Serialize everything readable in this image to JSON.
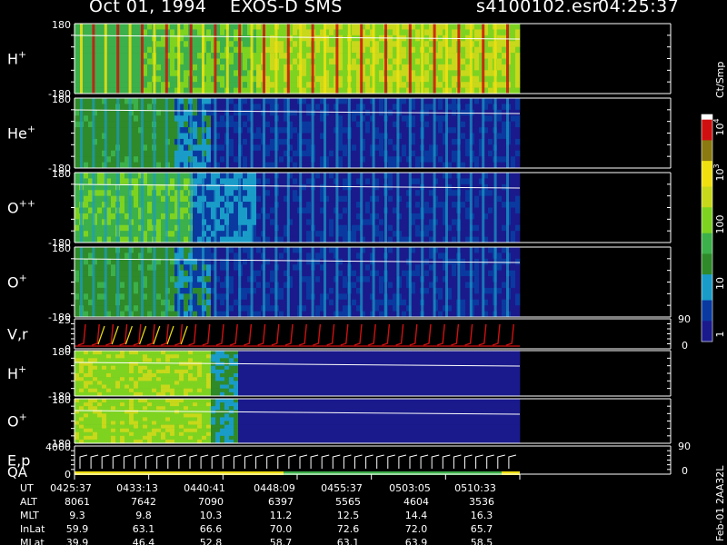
{
  "header": {
    "date": "Oct 01, 1994",
    "instrument": "EXOS-D SMS",
    "file": "s4100102.esr",
    "time": "04:25:37"
  },
  "colors": {
    "background": "#000000",
    "axes": "#ffffff",
    "scale": [
      "#1a1a8c",
      "#0a3aa0",
      "#1a9cc8",
      "#2f8a2a",
      "#3cb04a",
      "#7ed321",
      "#c8d81a",
      "#f0e010",
      "#8a7a10",
      "#d01010",
      "#ffffff"
    ]
  },
  "chart_data": {
    "type": "heatmap",
    "title": "Oct 01, 1994   EXOS-D SMS",
    "x_tick_labels": [
      "0425:37",
      "0433:13",
      "0440:41",
      "0448:09",
      "0455:37",
      "0503:05",
      "0510:33"
    ],
    "panels": [
      {
        "label": "H",
        "sup": "+",
        "ymax": "180",
        "ymin": "-180"
      },
      {
        "label": "He",
        "sup": "+",
        "ymax": "180",
        "ymin": "-180"
      },
      {
        "label": "O",
        "sup": "++",
        "ymax": "180",
        "ymin": "-180"
      },
      {
        "label": "O",
        "sup": "+",
        "ymax": "180",
        "ymin": "-180"
      },
      {
        "label": "V,r",
        "sup": "",
        "ymax": "25",
        "ymin": "0",
        "rmax": "90",
        "rmin": "0"
      },
      {
        "label": "H",
        "sup": "+",
        "ymax": "180",
        "ymin": "-180"
      },
      {
        "label": "O",
        "sup": "+",
        "ymax": "180",
        "ymin": "-180"
      },
      {
        "label": "E,p",
        "label2": "QA",
        "ymax": "4000",
        "ymin": "0",
        "rmax": "90",
        "rmin": "0"
      }
    ],
    "colorbar": {
      "unit": "Ct/Smp",
      "tick_labels": [
        "1",
        "10",
        "100",
        "10",
        "10"
      ],
      "tick_exponents": [
        "",
        "",
        "",
        "3",
        "4"
      ]
    },
    "table": {
      "rows": [
        {
          "label": "UT",
          "values": [
            "0425:37",
            "0433:13",
            "0440:41",
            "0448:09",
            "0455:37",
            "0503:05",
            "0510:33"
          ]
        },
        {
          "label": "ALT",
          "values": [
            "8061",
            "7642",
            "7090",
            "6397",
            "5565",
            "4604",
            "3536"
          ]
        },
        {
          "label": "MLT",
          "values": [
            "9.3",
            "9.8",
            "10.3",
            "11.2",
            "12.5",
            "14.4",
            "16.3"
          ]
        },
        {
          "label": "InLat",
          "values": [
            "59.9",
            "63.1",
            "66.6",
            "70.0",
            "72.6",
            "72.0",
            "65.7"
          ]
        },
        {
          "label": "MLat",
          "values": [
            "39.9",
            "46.4",
            "52.8",
            "58.7",
            "63.1",
            "63.9",
            "58.5"
          ]
        }
      ]
    }
  },
  "footer": {
    "vertical_note": "Feb-01  2AA32L"
  }
}
